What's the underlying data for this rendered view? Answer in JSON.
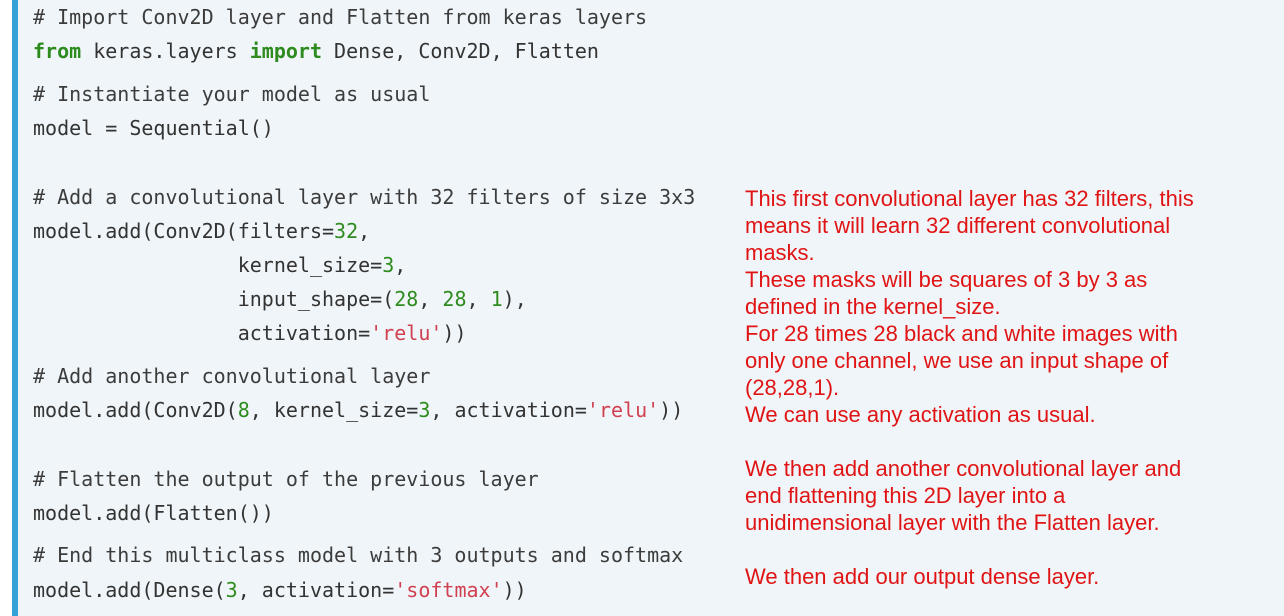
{
  "code": {
    "l1": "# Import Conv2D layer and Flatten from keras layers",
    "l2": {
      "kw1": "from",
      "mid": " keras.layers ",
      "kw2": "import",
      "rest": " Dense, Conv2D, Flatten"
    },
    "l3": "# Instantiate your model as usual",
    "l4": "model = Sequential()",
    "l5": "# Add a convolutional layer with 32 filters of size 3x3",
    "l6": {
      "pre": "model.add(Conv2D(filters=",
      "num": "32",
      "post": ","
    },
    "l7": {
      "pre": "                 kernel_size=",
      "num": "3",
      "post": ","
    },
    "l8": {
      "pre": "                 input_shape=(",
      "n1": "28",
      "sep1": ", ",
      "n2": "28",
      "sep2": ", ",
      "n3": "1",
      "post": "),"
    },
    "l9": {
      "pre": "                 activation=",
      "str": "'relu'",
      "post": "))"
    },
    "l10": "# Add another convolutional layer",
    "l11": {
      "pre": "model.add(Conv2D(",
      "n1": "8",
      "mid": ", kernel_size=",
      "n2": "3",
      "mid2": ", activation=",
      "str": "'relu'",
      "post": "))"
    },
    "l12": "# Flatten the output of the previous layer",
    "l13": "model.add(Flatten())",
    "l14": "# End this multiclass model with 3 outputs and softmax",
    "l15": {
      "pre": "model.add(Dense(",
      "num": "3",
      "mid": ", activation=",
      "str": "'softmax'",
      "post": "))"
    }
  },
  "notes": {
    "n1": "This first convolutional layer has 32 filters, this",
    "n2": "means it will learn 32 different convolutional",
    "n3": "masks.",
    "n4": "These masks will be squares of 3 by 3 as",
    "n5": "defined in the kernel_size.",
    "n6": "For 28 times 28 black and white images with",
    "n7": "only one channel, we use an input shape of",
    "n8": "(28,28,1).",
    "n9": "We can use any activation as usual.",
    "n10": "We then add another convolutional layer and",
    "n11": "end flattening this 2D layer into a",
    "n12": "unidimensional layer with the Flatten layer.",
    "n13": "We then add our output dense layer."
  },
  "colors": {
    "code_background": "#eff5f8",
    "accent_border": "#33a2d6",
    "keyword": "#2e8b1e",
    "number": "#2e8b1e",
    "string": "#d14050",
    "annotation_text": "#e01414"
  }
}
